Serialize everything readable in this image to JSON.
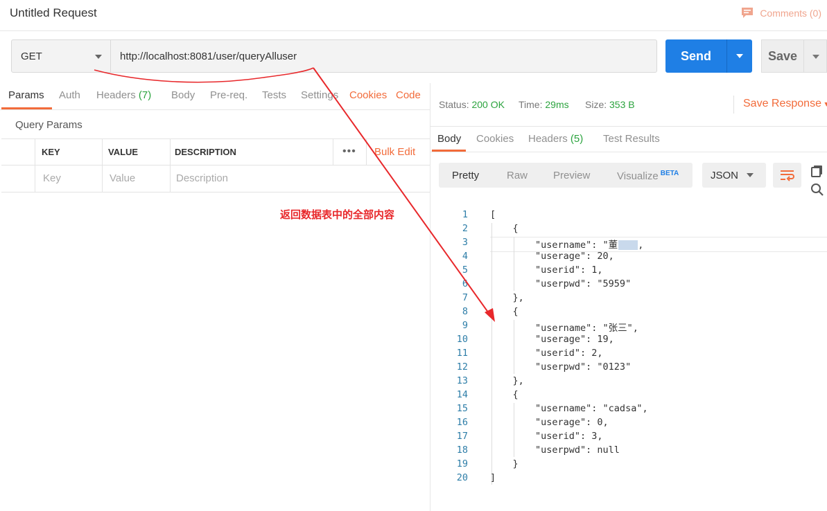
{
  "window": {
    "title": "Untitled Request",
    "comments_label": "Comments (0)"
  },
  "request": {
    "method": "GET",
    "url": "http://localhost:8081/user/queryAlluser",
    "send_label": "Send",
    "save_label": "Save"
  },
  "request_tabs": [
    {
      "label": "Params",
      "count": ""
    },
    {
      "label": "Auth",
      "count": ""
    },
    {
      "label": "Headers",
      "count": "(7)"
    },
    {
      "label": "Body",
      "count": ""
    },
    {
      "label": "Pre-req.",
      "count": ""
    },
    {
      "label": "Tests",
      "count": ""
    },
    {
      "label": "Settings",
      "count": ""
    }
  ],
  "request_links": {
    "cookies": "Cookies",
    "code": "Code"
  },
  "query_params": {
    "title": "Query Params",
    "headers": [
      "KEY",
      "VALUE",
      "DESCRIPTION"
    ],
    "placeholders": [
      "Key",
      "Value",
      "Description"
    ],
    "bulk_edit": "Bulk Edit",
    "more": "•••"
  },
  "response": {
    "status_label": "Status:",
    "status_value": "200 OK",
    "time_label": "Time:",
    "time_value": "29ms",
    "size_label": "Size:",
    "size_value": "353 B",
    "save_response": "Save Response"
  },
  "response_tabs": [
    {
      "label": "Body",
      "count": ""
    },
    {
      "label": "Cookies",
      "count": ""
    },
    {
      "label": "Headers",
      "count": "(5)"
    },
    {
      "label": "Test Results",
      "count": ""
    }
  ],
  "format": {
    "modes": [
      "Pretty",
      "Raw",
      "Preview",
      "Visualize"
    ],
    "beta": "BETA",
    "language": "JSON"
  },
  "body_lines": [
    "[",
    "    {",
    "        \"username\": \"董",
    "        \"userage\": 20,",
    "        \"userid\": 1,",
    "        \"userpwd\": \"5959\"",
    "    },",
    "    {",
    "        \"username\": \"张三\",",
    "        \"userage\": 19,",
    "        \"userid\": 2,",
    "        \"userpwd\": \"0123\"",
    "    },",
    "    {",
    "        \"username\": \"cadsa\",",
    "        \"userage\": 0,",
    "        \"userid\": 3,",
    "        \"userpwd\": null",
    "    }",
    "]"
  ],
  "line_numbers": [
    "1",
    "2",
    "3",
    "4",
    "5",
    "6",
    "7",
    "8",
    "9",
    "10",
    "11",
    "12",
    "13",
    "14",
    "15",
    "16",
    "17",
    "18",
    "19",
    "20"
  ],
  "annotation": {
    "text": "返回数据表中的全部内容",
    "color": "#e8282b"
  },
  "colors": {
    "accent": "#f26b3a",
    "primary": "#1f7fe5",
    "success": "#2ba33e"
  }
}
